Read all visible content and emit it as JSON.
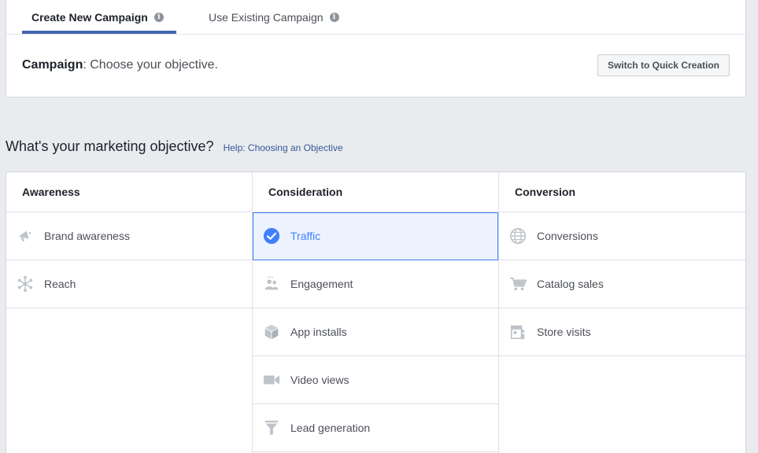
{
  "tabs": [
    {
      "label": "Create New Campaign",
      "active": true,
      "icon": "info-icon"
    },
    {
      "label": "Use Existing Campaign",
      "active": false,
      "icon": "info-icon"
    }
  ],
  "campaign": {
    "label": "Campaign",
    "text": ": Choose your objective."
  },
  "quick_button": "Switch to Quick Creation",
  "heading": "What's your marketing objective?",
  "help_link": "Help: Choosing an Objective",
  "columns": [
    {
      "title": "Awareness",
      "items": [
        {
          "label": "Brand awareness",
          "icon": "megaphone-icon"
        },
        {
          "label": "Reach",
          "icon": "reach-icon"
        }
      ]
    },
    {
      "title": "Consideration",
      "items": [
        {
          "label": "Traffic",
          "icon": "check-circle-icon",
          "selected": true
        },
        {
          "label": "Engagement",
          "icon": "people-icon"
        },
        {
          "label": "App installs",
          "icon": "box-icon"
        },
        {
          "label": "Video views",
          "icon": "video-camera-icon"
        },
        {
          "label": "Lead generation",
          "icon": "funnel-icon"
        }
      ]
    },
    {
      "title": "Conversion",
      "items": [
        {
          "label": "Conversions",
          "icon": "globe-icon"
        },
        {
          "label": "Catalog sales",
          "icon": "cart-icon"
        },
        {
          "label": "Store visits",
          "icon": "store-icon"
        }
      ]
    }
  ],
  "colors": {
    "accent": "#4267b2",
    "selected_text": "#4080ff",
    "selected_bg": "#ecf3ff",
    "icon_gray": "#bec3c9"
  }
}
